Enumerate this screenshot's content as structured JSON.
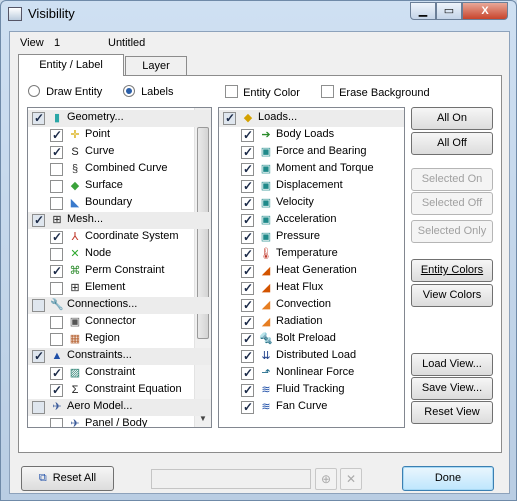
{
  "window": {
    "title": "Visibility",
    "close_label": "X"
  },
  "header": {
    "view_label": "View",
    "view_number": "1",
    "view_name": "Untitled"
  },
  "tabs": [
    {
      "label": "Entity / Label"
    },
    {
      "label": "Layer"
    }
  ],
  "options": {
    "draw_entity": "Draw Entity",
    "labels": "Labels",
    "entity_color": "Entity Color",
    "erase_background": "Erase Background"
  },
  "left_list": [
    {
      "label": "Geometry...",
      "group": true,
      "checked": true,
      "icon": "geometry-icon",
      "glyph": "▮",
      "color": "#2aa7a7"
    },
    {
      "label": "Point",
      "checked": true,
      "icon": "point-icon",
      "glyph": "✛",
      "color": "#d6a800"
    },
    {
      "label": "Curve",
      "checked": true,
      "icon": "curve-icon",
      "glyph": "S",
      "color": "#222"
    },
    {
      "label": "Combined Curve",
      "checked": false,
      "icon": "combined-curve-icon",
      "glyph": "§",
      "color": "#333"
    },
    {
      "label": "Surface",
      "checked": false,
      "icon": "surface-icon",
      "glyph": "◆",
      "color": "#3aa23a"
    },
    {
      "label": "Boundary",
      "checked": false,
      "icon": "boundary-icon",
      "glyph": "◣",
      "color": "#3a7acc"
    },
    {
      "label": "Mesh...",
      "group": true,
      "checked": true,
      "icon": "mesh-icon",
      "glyph": "⊞",
      "color": "#222"
    },
    {
      "label": "Coordinate System",
      "checked": true,
      "icon": "coordinate-system-icon",
      "glyph": "⅄",
      "color": "#c0392b"
    },
    {
      "label": "Node",
      "checked": false,
      "icon": "node-icon",
      "glyph": "✕",
      "color": "#2ea82e"
    },
    {
      "label": "Perm Constraint",
      "checked": true,
      "icon": "perm-constraint-icon",
      "glyph": "⌘",
      "color": "#2a8a2a"
    },
    {
      "label": "Element",
      "checked": false,
      "icon": "element-icon",
      "glyph": "⊞",
      "color": "#222"
    },
    {
      "label": "Connections...",
      "group": true,
      "checked": false,
      "icon": "connections-icon",
      "glyph": "🔧",
      "color": "#555"
    },
    {
      "label": "Connector",
      "checked": false,
      "icon": "connector-icon",
      "glyph": "▣",
      "color": "#555"
    },
    {
      "label": "Region",
      "checked": false,
      "icon": "region-icon",
      "glyph": "▦",
      "color": "#b35c2a"
    },
    {
      "label": "Constraints...",
      "group": true,
      "checked": true,
      "icon": "constraints-icon",
      "glyph": "▲",
      "color": "#1f4fa8"
    },
    {
      "label": "Constraint",
      "checked": true,
      "icon": "constraint-icon",
      "glyph": "▨",
      "color": "#1f7a6a"
    },
    {
      "label": "Constraint Equation",
      "checked": true,
      "icon": "constraint-equation-icon",
      "glyph": "Σ",
      "color": "#222"
    },
    {
      "label": "Aero Model...",
      "group": true,
      "checked": false,
      "icon": "aero-model-icon",
      "glyph": "✈",
      "color": "#3a5a9a"
    },
    {
      "label": "Panel / Body",
      "checked": false,
      "icon": "panel-body-icon",
      "glyph": "✈",
      "color": "#3a5a9a"
    }
  ],
  "right_list": [
    {
      "label": "Loads...",
      "group": true,
      "checked": true,
      "icon": "loads-icon",
      "glyph": "◆",
      "color": "#d4a100"
    },
    {
      "label": "Body Loads",
      "checked": true,
      "icon": "body-loads-icon",
      "glyph": "➔",
      "color": "#2a8a2a"
    },
    {
      "label": "Force and Bearing",
      "checked": true,
      "icon": "force-bearing-icon",
      "glyph": "▣",
      "color": "#1f8a8a"
    },
    {
      "label": "Moment and Torque",
      "checked": true,
      "icon": "moment-torque-icon",
      "glyph": "▣",
      "color": "#1f8a8a"
    },
    {
      "label": "Displacement",
      "checked": true,
      "icon": "displacement-icon",
      "glyph": "▣",
      "color": "#1f8a8a"
    },
    {
      "label": "Velocity",
      "checked": true,
      "icon": "velocity-icon",
      "glyph": "▣",
      "color": "#1f8a8a"
    },
    {
      "label": "Acceleration",
      "checked": true,
      "icon": "acceleration-icon",
      "glyph": "▣",
      "color": "#1f8a8a"
    },
    {
      "label": "Pressure",
      "checked": true,
      "icon": "pressure-icon",
      "glyph": "▣",
      "color": "#1f8a8a"
    },
    {
      "label": "Temperature",
      "checked": true,
      "icon": "thermometer-icon",
      "glyph": "🌡",
      "color": "#c0392b"
    },
    {
      "label": "Heat Generation",
      "checked": true,
      "icon": "heat-generation-icon",
      "glyph": "◢",
      "color": "#d35400"
    },
    {
      "label": "Heat Flux",
      "checked": true,
      "icon": "heat-flux-icon",
      "glyph": "◢",
      "color": "#d35400"
    },
    {
      "label": "Convection",
      "checked": true,
      "icon": "convection-icon",
      "glyph": "◢",
      "color": "#e67e22"
    },
    {
      "label": "Radiation",
      "checked": true,
      "icon": "radiation-icon",
      "glyph": "◢",
      "color": "#e67e22"
    },
    {
      "label": "Bolt Preload",
      "checked": true,
      "icon": "bolt-preload-icon",
      "glyph": "🔩",
      "color": "#1f3f8a"
    },
    {
      "label": "Distributed Load",
      "checked": true,
      "icon": "distributed-load-icon",
      "glyph": "⇊",
      "color": "#1f3f8a"
    },
    {
      "label": "Nonlinear Force",
      "checked": true,
      "icon": "nonlinear-force-icon",
      "glyph": "⬏",
      "color": "#1f6a8a"
    },
    {
      "label": "Fluid Tracking",
      "checked": true,
      "icon": "fluid-tracking-icon",
      "glyph": "≋",
      "color": "#1f4fa8"
    },
    {
      "label": "Fan Curve",
      "checked": true,
      "icon": "fan-curve-icon",
      "glyph": "≋",
      "color": "#1f4fa8"
    }
  ],
  "buttons": {
    "all_on": "All On",
    "all_off": "All Off",
    "selected_on": "Selected On",
    "selected_off": "Selected Off",
    "selected_only": "Selected Only",
    "entity_colors": "Entity Colors",
    "view_colors": "View Colors",
    "load_view": "Load View...",
    "save_view": "Save View...",
    "reset_view": "Reset View",
    "reset_all": "Reset All",
    "done": "Done"
  }
}
